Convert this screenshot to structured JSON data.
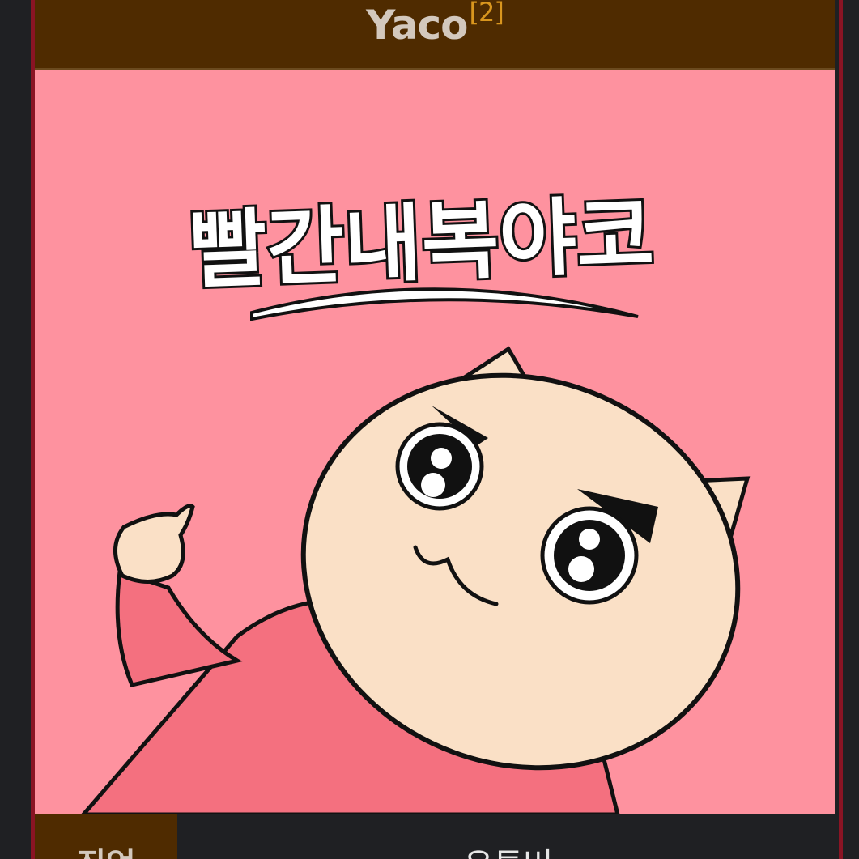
{
  "header": {
    "title": "Yaco",
    "footnote": "[2]"
  },
  "image": {
    "caption_text": "빨간내복야코",
    "background_color": "#fe929f"
  },
  "info_row": {
    "label": "직업",
    "value": "유튜버"
  },
  "colors": {
    "header_bg": "#4f2b00",
    "accent_border": "#8a1424",
    "page_bg": "#1f2023",
    "footnote": "#d9961e"
  }
}
